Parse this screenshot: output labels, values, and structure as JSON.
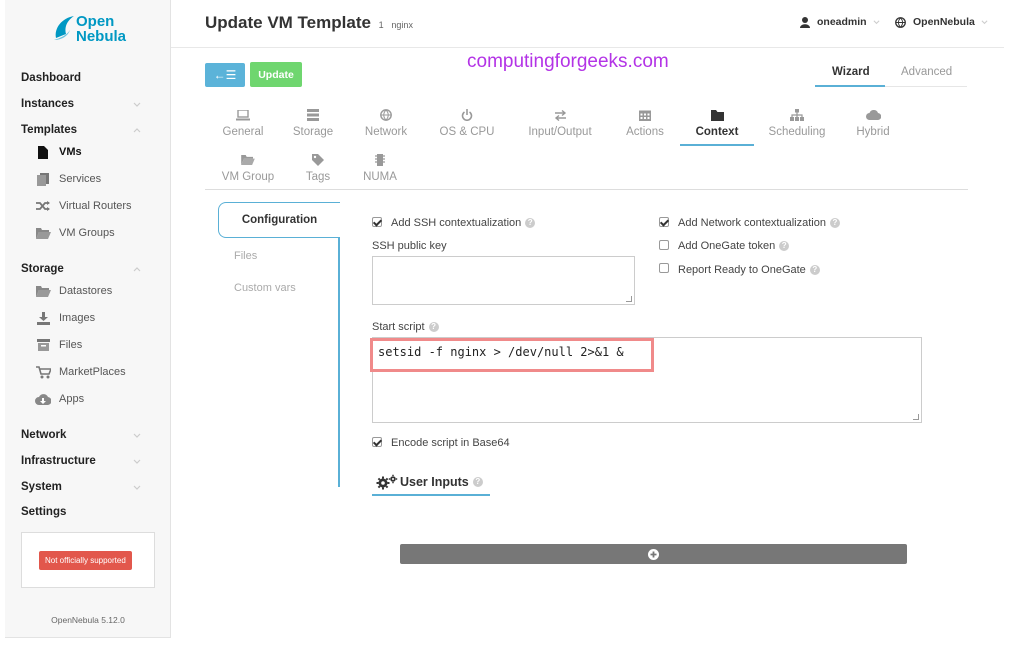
{
  "brand": {
    "line1": "Open",
    "line2": "Nebula"
  },
  "sidebar": {
    "dashboard": "Dashboard",
    "instances": "Instances",
    "templates": "Templates",
    "templates_items": [
      "VMs",
      "Services",
      "Virtual Routers",
      "VM Groups"
    ],
    "storage": "Storage",
    "storage_items": [
      "Datastores",
      "Images",
      "Files",
      "MarketPlaces",
      "Apps"
    ],
    "network": "Network",
    "infrastructure": "Infrastructure",
    "system": "System",
    "settings": "Settings",
    "support_badge": "Not officially supported",
    "version": "OpenNebula 5.12.0"
  },
  "header": {
    "title": "Update VM Template",
    "id": "1",
    "name": "nginx",
    "user": "oneadmin",
    "zone": "OpenNebula"
  },
  "toolbar": {
    "back_label": "←☰",
    "update_label": "Update"
  },
  "watermark": "computingforgeeks.com",
  "mode_tabs": {
    "wizard": "Wizard",
    "advanced": "Advanced"
  },
  "tabs": [
    "General",
    "Storage",
    "Network",
    "OS & CPU",
    "Input/Output",
    "Actions",
    "Context",
    "Scheduling",
    "Hybrid",
    "VM Group",
    "Tags",
    "NUMA"
  ],
  "vtabs": {
    "configuration": "Configuration",
    "files": "Files",
    "custom_vars": "Custom vars"
  },
  "form": {
    "ssh_context": "Add SSH contextualization",
    "ssh_key": "SSH public key",
    "net_context": "Add Network contextualization",
    "onegate_token": "Add OneGate token",
    "report_ready": "Report Ready to OneGate",
    "start_script": "Start script",
    "script_value": "setsid -f nginx > /dev/null 2>&1 &",
    "encode_base64": "Encode script in Base64",
    "user_inputs": "User Inputs",
    "help": "?"
  },
  "colors": {
    "accent": "#5ab0d6",
    "update": "#6fd66f",
    "back": "#5bb3d9",
    "watermark": "#b333e6",
    "highlight": "#f08a8a",
    "badge": "#e2574c"
  }
}
